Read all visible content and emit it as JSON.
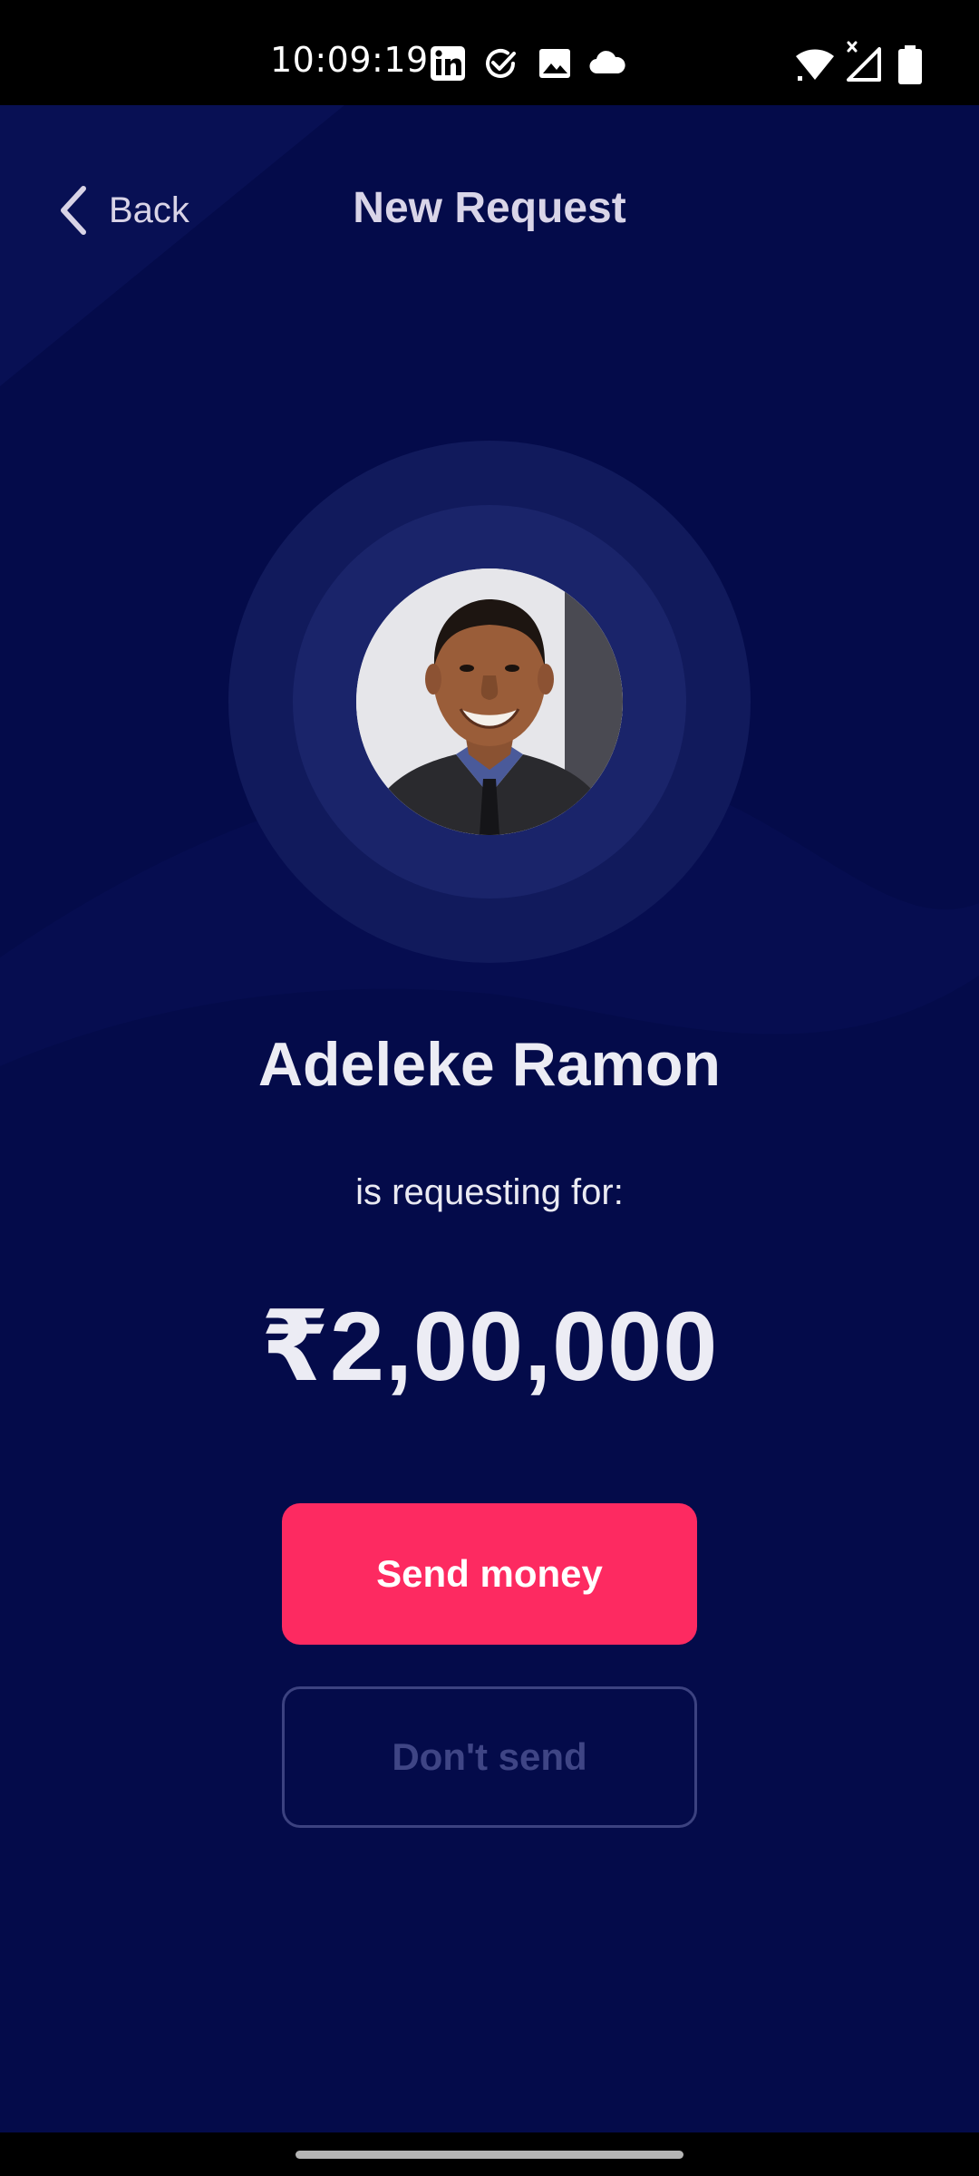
{
  "status_bar": {
    "time": "10:09:19",
    "left_icons": [
      "linkedin-icon",
      "check-circle-icon",
      "gallery-icon",
      "cloud-icon"
    ],
    "right_icons": [
      "wifi-icon",
      "cellular-signal-icon",
      "battery-icon"
    ]
  },
  "header": {
    "back_label": "Back",
    "title": "New Request"
  },
  "requester": {
    "name": "Adeleke Ramon",
    "subtitle": "is requesting for:",
    "amount": "₹2,00,000"
  },
  "actions": {
    "send_label": "Send money",
    "dont_send_label": "Don't send"
  },
  "colors": {
    "background": "#040b4a",
    "primary_button": "#fd2a61",
    "secondary_button_border": "#3c4280",
    "text": "#ececf4"
  }
}
